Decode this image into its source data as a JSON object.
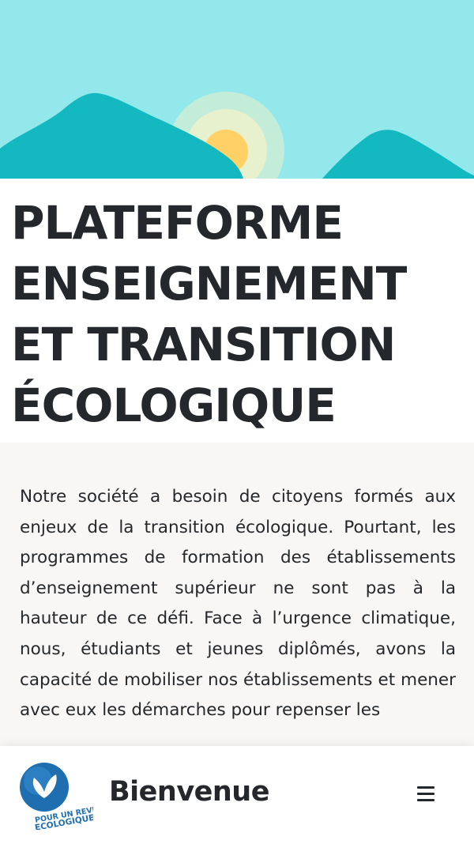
{
  "hero": {
    "sky_color": "#93e8ec",
    "mountain_color": "#13b8c0",
    "sun_color": "#ffd166",
    "halo_color": "#fff3c4"
  },
  "title": {
    "text": "PLATEFORME\nENSEIGNEMENT\nET TRANSITION\nÉCOLOGIQUE"
  },
  "intro": {
    "text": "Notre société a besoin de citoyens formés aux enjeux de la transition écologique. Pourtant, les programmes de formation des établissements d’enseignement supérieur ne sont pas à la hauteur de ce défi. Face à l’urgence climatique, nous, étudiants et jeunes diplômés, avons la capacité de mobiliser nos établissements et mener avec eux les démarches pour repenser les"
  },
  "bottom_bar": {
    "logo_text_line1": "POUR UN REVEIL",
    "logo_text_line2": "ECOLOGIQUE",
    "title": "Bienvenue",
    "menu_icon": "hamburger-menu-icon"
  }
}
